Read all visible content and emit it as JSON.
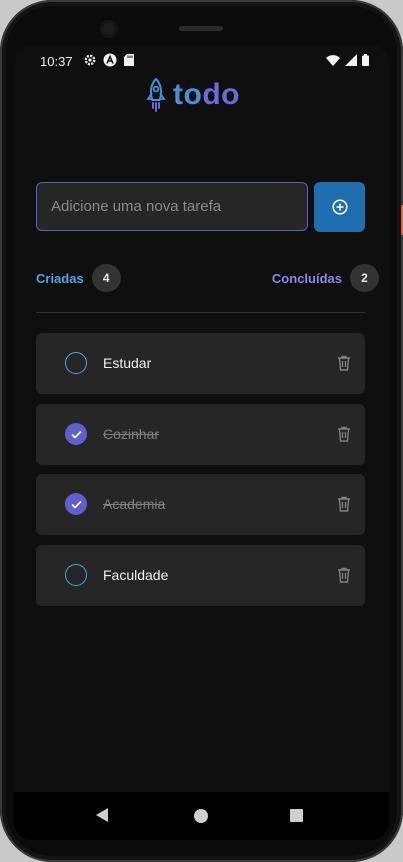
{
  "status_bar": {
    "time": "10:37",
    "left_icons": [
      "gear-icon",
      "a-badge-icon",
      "sd-card-icon"
    ],
    "right_icons": [
      "wifi-icon",
      "signal-icon",
      "battery-icon"
    ]
  },
  "app": {
    "logo_text_a": "to",
    "logo_text_b": "do",
    "logo_icon": "rocket-icon",
    "brand_colors": {
      "blue": "#4a8fd8",
      "purple": "#6f6ad6"
    }
  },
  "new_task": {
    "placeholder": "Adicione uma nova tarefa",
    "value": "",
    "add_icon": "plus-circle-icon"
  },
  "counters": {
    "created_label": "Criadas",
    "created_count": "4",
    "done_label": "Concluídas",
    "done_count": "2"
  },
  "tasks": [
    {
      "label": "Estudar",
      "completed": false
    },
    {
      "label": "Cozinhar",
      "completed": true
    },
    {
      "label": "Academia",
      "completed": true
    },
    {
      "label": "Faculdade",
      "completed": false
    }
  ],
  "nav": {
    "icons": [
      "back-icon",
      "home-icon",
      "recents-icon"
    ]
  }
}
